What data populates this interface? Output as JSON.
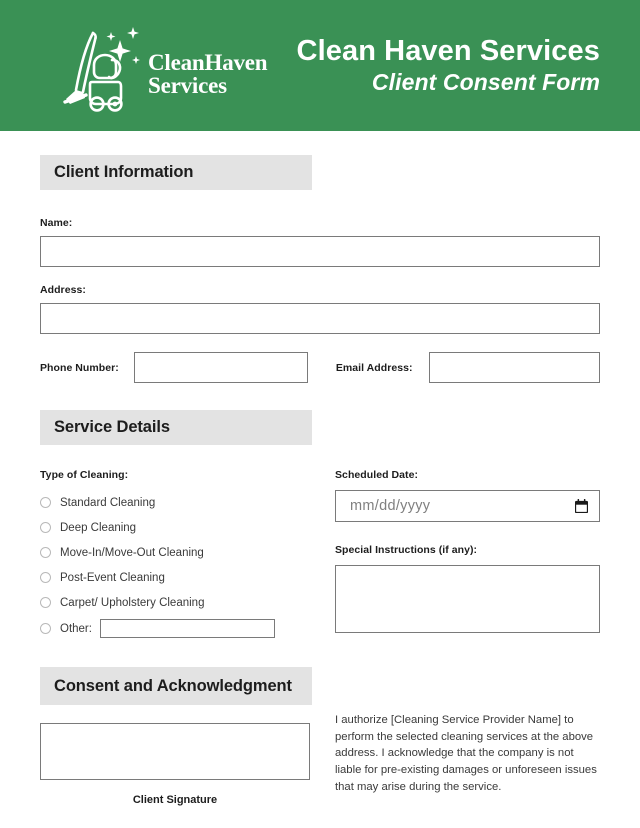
{
  "header": {
    "company_name": "Clean Haven Services",
    "form_title": "Client Consent Form",
    "logo_line1": "CleanHaven",
    "logo_line2": "Services",
    "logo_icon": "vacuum-cleaner-sparkle-icon",
    "background_color": "#3a9155",
    "text_color": "#ffffff"
  },
  "sections": {
    "client_information": {
      "title": "Client Information",
      "fields": {
        "name": {
          "label": "Name:",
          "value": "",
          "placeholder": ""
        },
        "address": {
          "label": "Address:",
          "value": "",
          "placeholder": ""
        },
        "phone": {
          "label": "Phone Number:",
          "value": "",
          "placeholder": ""
        },
        "email": {
          "label": "Email Address:",
          "value": "",
          "placeholder": ""
        }
      }
    },
    "service_details": {
      "title": "Service Details",
      "type_of_cleaning": {
        "label": "Type of Cleaning:",
        "options": [
          "Standard Cleaning",
          "Deep Cleaning",
          "Move-In/Move-Out Cleaning",
          "Post-Event Cleaning",
          "Carpet/ Upholstery Cleaning"
        ],
        "other_label": "Other:",
        "other_value": ""
      },
      "scheduled_date": {
        "label": "Scheduled Date:",
        "placeholder": "mm/dd/yyyy",
        "value": "",
        "icon": "calendar-icon"
      },
      "special_instructions": {
        "label": "Special Instructions (if any):",
        "value": ""
      }
    },
    "consent": {
      "title": "Consent and Acknowledgment",
      "signature_caption": "Client Signature",
      "signature_value": "",
      "text": "I authorize [Cleaning Service Provider Name] to perform the selected cleaning services at the above address. I acknowledge that the company is not liable for pre-existing damages or unforeseen issues that may arise during the service."
    }
  },
  "theme": {
    "section_bar_background": "#e3e3e3",
    "border_color": "#7a7a7a",
    "body_text_color": "#3a3a3a"
  }
}
